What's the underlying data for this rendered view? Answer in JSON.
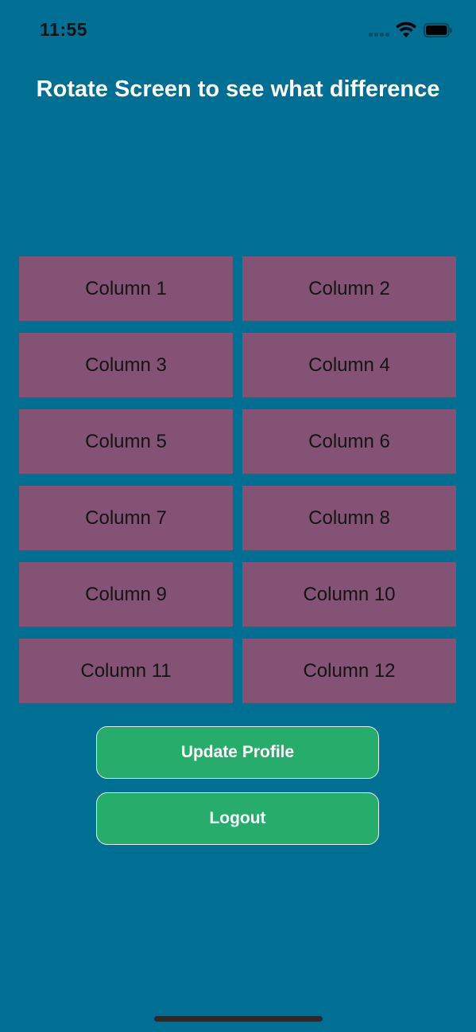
{
  "status_bar": {
    "time": "11:55"
  },
  "header": {
    "title": "Rotate Screen to see what difference"
  },
  "grid": {
    "cells": [
      "Column 1",
      "Column 2",
      "Column 3",
      "Column 4",
      "Column 5",
      "Column 6",
      "Column 7",
      "Column 8",
      "Column 9",
      "Column 10",
      "Column 11",
      "Column 12"
    ]
  },
  "actions": {
    "update_label": "Update Profile",
    "logout_label": "Logout"
  },
  "colors": {
    "background": "#006f94",
    "cell": "#845274",
    "button": "#26ad6b"
  },
  "icons": [
    "cellular-signal-icon",
    "wifi-icon",
    "battery-icon"
  ]
}
